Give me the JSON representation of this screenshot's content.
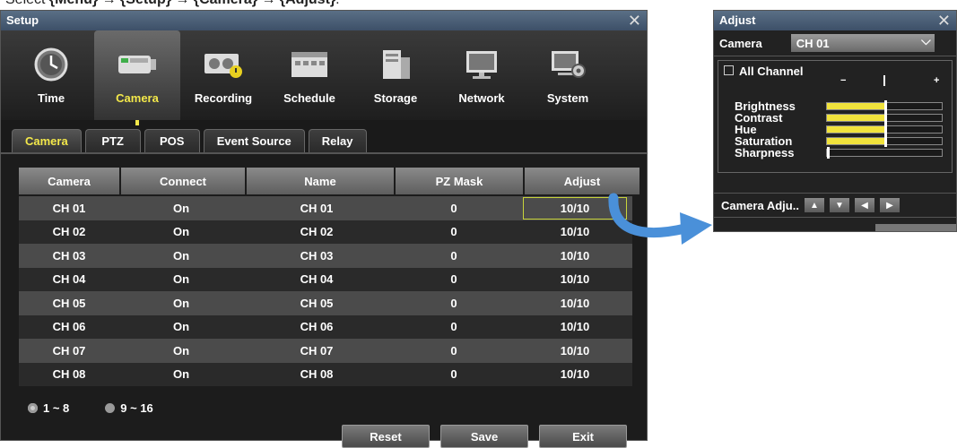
{
  "caption": {
    "prefix": "Select ",
    "steps": [
      "{Menu}",
      "{Setup}",
      "{Camera}",
      "{Adjust}"
    ],
    "separator": " → ",
    "suffix": "."
  },
  "setup_window": {
    "title": "Setup",
    "close_glyph": "✕",
    "menu": [
      {
        "label": "Time",
        "icon": "clock-icon",
        "active": false
      },
      {
        "label": "Camera",
        "icon": "camera-icon",
        "active": true
      },
      {
        "label": "Recording",
        "icon": "recording-icon",
        "active": false
      },
      {
        "label": "Schedule",
        "icon": "schedule-icon",
        "active": false
      },
      {
        "label": "Storage",
        "icon": "storage-icon",
        "active": false
      },
      {
        "label": "Network",
        "icon": "network-icon",
        "active": false
      },
      {
        "label": "System",
        "icon": "system-icon",
        "active": false
      }
    ],
    "subtabs": [
      {
        "label": "Camera",
        "active": true
      },
      {
        "label": "PTZ",
        "active": false
      },
      {
        "label": "POS",
        "active": false
      },
      {
        "label": "Event Source",
        "active": false
      },
      {
        "label": "Relay",
        "active": false
      }
    ],
    "table": {
      "columns": [
        "Camera",
        "Connect",
        "Name",
        "PZ Mask",
        "Adjust"
      ],
      "rows": [
        [
          "CH 01",
          "On",
          "CH 01",
          "0",
          "10/10"
        ],
        [
          "CH 02",
          "On",
          "CH 02",
          "0",
          "10/10"
        ],
        [
          "CH 03",
          "On",
          "CH 03",
          "0",
          "10/10"
        ],
        [
          "CH 04",
          "On",
          "CH 04",
          "0",
          "10/10"
        ],
        [
          "CH 05",
          "On",
          "CH 05",
          "0",
          "10/10"
        ],
        [
          "CH 06",
          "On",
          "CH 06",
          "0",
          "10/10"
        ],
        [
          "CH 07",
          "On",
          "CH 07",
          "0",
          "10/10"
        ],
        [
          "CH 08",
          "On",
          "CH 08",
          "0",
          "10/10"
        ]
      ],
      "selected_row": 0
    },
    "pager": [
      {
        "label": "1 ~ 8",
        "selected": true
      },
      {
        "label": "9 ~ 16",
        "selected": false
      }
    ],
    "buttons": {
      "reset": "Reset",
      "save": "Save",
      "exit": "Exit"
    }
  },
  "adjust_window": {
    "title": "Adjust",
    "close_glyph": "✕",
    "camera_label": "Camera",
    "camera_value": "CH 01",
    "all_channel": "All Channel",
    "scale_minus": "−",
    "scale_plus": "+",
    "sliders": [
      {
        "label": "Brightness",
        "value": 0.5
      },
      {
        "label": "Contrast",
        "value": 0.5
      },
      {
        "label": "Hue",
        "value": 0.5
      },
      {
        "label": "Saturation",
        "value": 0.5
      },
      {
        "label": "Sharpness",
        "value": 0.0
      }
    ],
    "camera_adjust_label": "Camera Adju..",
    "nav_glyphs": [
      "▲",
      "▼",
      "◀",
      "▶"
    ]
  },
  "colors": {
    "accent_yellow": "#f3e84a",
    "arrow_blue": "#4a90d9",
    "titlebar": "#4a5d74"
  }
}
